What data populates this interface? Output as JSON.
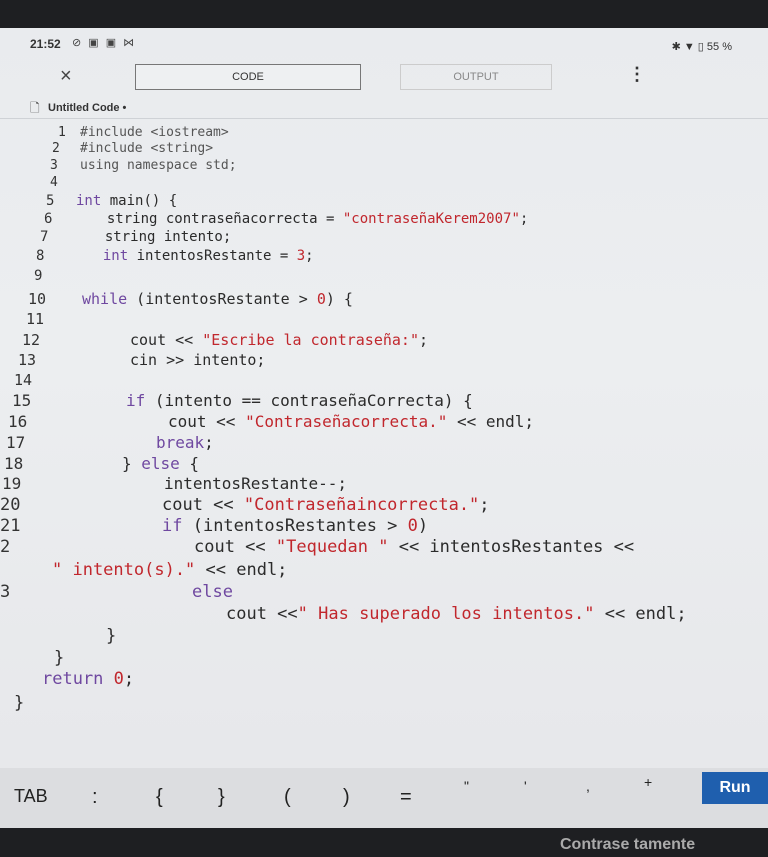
{
  "status_bar": {
    "time": "21:52",
    "left_icons": "⊘ ▣ ▣ ⋈",
    "right_icons": "✱ ▼ ▯ 55 %"
  },
  "tabs": {
    "close_symbol": "×",
    "code_label": "CODE",
    "output_label": "OUTPUT",
    "menu_symbol": "⋮"
  },
  "file": {
    "icon": "document-icon",
    "name": "Untitled Code •"
  },
  "code": {
    "lines": [
      {
        "n": "1",
        "segments": [
          {
            "t": "#include <iostream>",
            "c": "pp"
          }
        ]
      },
      {
        "n": "2",
        "segments": [
          {
            "t": "#include <string>",
            "c": "pp"
          }
        ]
      },
      {
        "n": "3",
        "segments": [
          {
            "t": "using namespace std;",
            "c": "pp"
          }
        ]
      },
      {
        "n": "4",
        "segments": []
      },
      {
        "n": "5",
        "segments": [
          {
            "t": "int",
            "c": "kw"
          },
          {
            "t": " main() {",
            "c": ""
          }
        ]
      },
      {
        "n": "6",
        "segments": [
          {
            "t": "  string contraseñacorrecta = ",
            "c": ""
          },
          {
            "t": "\"contraseñaKerem2007\"",
            "c": "str"
          },
          {
            "t": ";",
            "c": ""
          }
        ]
      },
      {
        "n": "7",
        "segments": [
          {
            "t": "  string intento;",
            "c": ""
          }
        ]
      },
      {
        "n": "8",
        "segments": [
          {
            "t": "  ",
            "c": ""
          },
          {
            "t": "int",
            "c": "kw"
          },
          {
            "t": " intentosRestante = ",
            "c": ""
          },
          {
            "t": "3",
            "c": "num"
          },
          {
            "t": ";",
            "c": ""
          }
        ]
      },
      {
        "n": "9",
        "segments": []
      },
      {
        "n": "10",
        "segments": [
          {
            "t": "while",
            "c": "kw"
          },
          {
            "t": " (intentosRestante > ",
            "c": ""
          },
          {
            "t": "0",
            "c": "num"
          },
          {
            "t": ") {",
            "c": ""
          }
        ]
      },
      {
        "n": "11",
        "segments": []
      },
      {
        "n": "12",
        "segments": [
          {
            "t": "cout << ",
            "c": ""
          },
          {
            "t": "\"Escribe la contraseña:\"",
            "c": "str"
          },
          {
            "t": ";",
            "c": ""
          }
        ]
      },
      {
        "n": "13",
        "segments": [
          {
            "t": "cin >> intento;",
            "c": ""
          }
        ]
      },
      {
        "n": "14",
        "segments": []
      },
      {
        "n": "15",
        "segments": [
          {
            "t": "if",
            "c": "kw"
          },
          {
            "t": " (intento == contraseñaCorrecta) {",
            "c": ""
          }
        ]
      },
      {
        "n": "16",
        "segments": [
          {
            "t": "cout << ",
            "c": ""
          },
          {
            "t": "\"Contraseñacorrecta.\"",
            "c": "str"
          },
          {
            "t": " << endl;",
            "c": ""
          }
        ]
      },
      {
        "n": "17",
        "segments": [
          {
            "t": "break",
            "c": "kw"
          },
          {
            "t": ";",
            "c": ""
          }
        ]
      },
      {
        "n": "18",
        "segments": [
          {
            "t": "} ",
            "c": ""
          },
          {
            "t": "else",
            "c": "kw"
          },
          {
            "t": " {",
            "c": ""
          }
        ]
      },
      {
        "n": "19",
        "segments": [
          {
            "t": "intentosRestante--;",
            "c": ""
          }
        ]
      },
      {
        "n": "20",
        "segments": [
          {
            "t": "cout << ",
            "c": ""
          },
          {
            "t": "\"Contraseñaincorrecta.\"",
            "c": "str"
          },
          {
            "t": ";",
            "c": ""
          }
        ]
      },
      {
        "n": "21",
        "segments": [
          {
            "t": "if",
            "c": "kw"
          },
          {
            "t": " (intentosRestantes > ",
            "c": ""
          },
          {
            "t": "0",
            "c": "num"
          },
          {
            "t": ")",
            "c": ""
          }
        ]
      },
      {
        "n": "2",
        "segments": [
          {
            "t": "cout << ",
            "c": ""
          },
          {
            "t": "\"Tequedan \"",
            "c": "str"
          },
          {
            "t": " << intentosRestantes <<",
            "c": ""
          }
        ]
      },
      {
        "n": "",
        "segments": [
          {
            "t": "\" intento(s).\"",
            "c": "str"
          },
          {
            "t": " << endl;",
            "c": ""
          }
        ]
      },
      {
        "n": "3",
        "segments": [
          {
            "t": "else",
            "c": "kw"
          }
        ]
      },
      {
        "n": "",
        "segments": [
          {
            "t": "cout <<",
            "c": ""
          },
          {
            "t": "\" Has superado los intentos.\"",
            "c": "str"
          },
          {
            "t": " << endl;",
            "c": ""
          }
        ]
      },
      {
        "n": "",
        "segments": [
          {
            "t": "}",
            "c": ""
          }
        ]
      },
      {
        "n": "",
        "segments": [
          {
            "t": "}",
            "c": ""
          }
        ]
      },
      {
        "n": "",
        "segments": [
          {
            "t": "return",
            "c": "kw"
          },
          {
            "t": " ",
            "c": ""
          },
          {
            "t": "0",
            "c": "num"
          },
          {
            "t": ";",
            "c": ""
          }
        ]
      },
      {
        "n": "",
        "segments": [
          {
            "t": "}",
            "c": ""
          }
        ]
      }
    ]
  },
  "keyboard": {
    "keys": [
      "TAB",
      ":",
      "{",
      "}",
      "(",
      ")",
      "=",
      "\"",
      "'",
      ",",
      "+"
    ],
    "run_label": "Run"
  },
  "below_screen_text": "Contrase tamente"
}
